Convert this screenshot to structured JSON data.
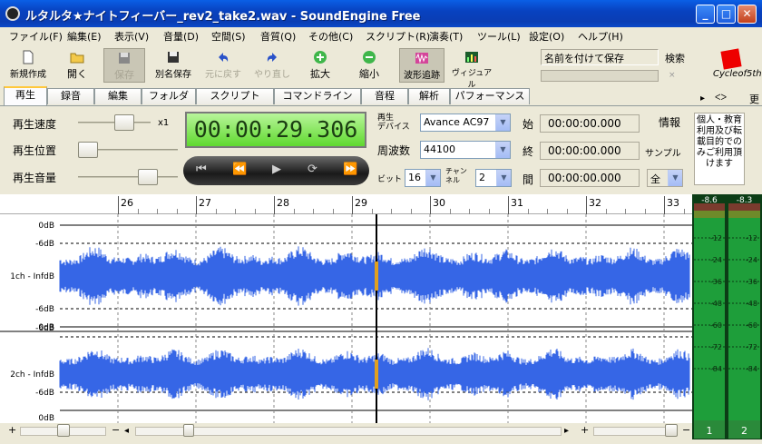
{
  "window": {
    "title": "ルタルタ★ナイトフィーバー_rev2_take2.wav - SoundEngine Free",
    "min": "_",
    "max": "□",
    "close": "✕"
  },
  "menu": [
    "ファイル(F)",
    "編集(E)",
    "表示(V)",
    "音量(D)",
    "空間(S)",
    "音質(Q)",
    "その他(C)",
    "スクリプト(R)",
    "演奏(T)",
    "ツール(L)",
    "設定(O)",
    "ヘルプ(H)"
  ],
  "toolbar": {
    "new": "新規作成",
    "open": "開く",
    "save": "保存",
    "save_as": "別名保存",
    "undo": "元に戻す",
    "redo": "やり直し",
    "zoom_in": "拡大",
    "zoom_out": "縮小",
    "wave_track": "波形追跡",
    "visual": "ヴィジュアル",
    "save_name_placeholder": "名前を付けて保存",
    "search": "検索",
    "small_close": "×"
  },
  "logo": {
    "text": "Cycleof5th"
  },
  "tabs": [
    "再生",
    "録音",
    "編集",
    "フォルダ",
    "スクリプト",
    "コマンドライン",
    "音程",
    "解析",
    "パフォーマンス"
  ],
  "tab_nav": {
    "arrow": "▸",
    "extra": "ᐸᐳ",
    "more": "更"
  },
  "playback": {
    "speed_label": "再生速度",
    "position_label": "再生位置",
    "volume_label": "再生音量",
    "speed_value": "x1",
    "time": "00:00:29.306",
    "device_label": "再生\nデバイス",
    "device_value": "Avance AC97",
    "freq_label": "周波数",
    "freq_value": "44100",
    "bit_label": "ビット",
    "bit_value": "16",
    "ch_label": "チャン\nネル",
    "ch_value": "2",
    "start_label": "始",
    "start_value": "00:00:00.000",
    "end_label": "終",
    "end_value": "00:00:00.000",
    "len_label": "間",
    "len_value": "00:00:00.000",
    "info_label": "情報",
    "sample_label": "サンプル",
    "all_label": "全",
    "notice": "個人・教育利用及び転載目的でのみご利用頂けます"
  },
  "transport": {
    "rewind_start": "⏮",
    "rewind": "⏪",
    "play": "▶",
    "loop": "⟳",
    "forward": "⏩"
  },
  "ruler": [
    "26",
    "27",
    "28",
    "29",
    "30",
    "31",
    "32",
    "33"
  ],
  "channels": [
    {
      "name": "1ch",
      "labels": [
        "0dB",
        "-6dB",
        "1ch - InfdB",
        "-6dB",
        "0dB"
      ]
    },
    {
      "name": "2ch",
      "labels": [
        "-6dB",
        "2ch - InfdB",
        "-6dB",
        "0dB"
      ]
    }
  ],
  "meters": {
    "peaks": [
      "-8.6",
      "-8.3"
    ],
    "scale": [
      "-12",
      "-24",
      "-36",
      "-48",
      "-60",
      "-72",
      "-84"
    ],
    "channel_labels": [
      "1",
      "2"
    ]
  },
  "scrollbar": {
    "plus": "+",
    "minus": "−"
  },
  "colors": {
    "wave": "#3666e6",
    "playhead": "#000000",
    "timer_bg": "#7be448",
    "meter_green": "#1e9e3a"
  }
}
